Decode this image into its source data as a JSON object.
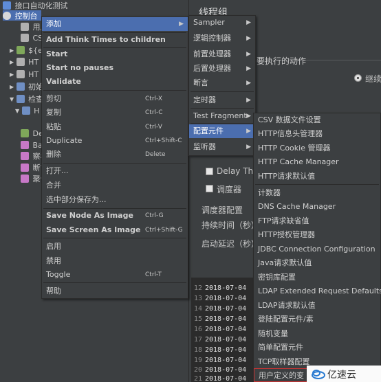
{
  "tree": {
    "root_label": "接口自动化测试",
    "selected_label": "控制台",
    "items": [
      "用户",
      "CSV",
      "${e",
      "HT",
      "HT",
      "初始",
      "检查",
      "H",
      "Del",
      "Bac",
      "察看",
      "断言",
      "聚合"
    ]
  },
  "right_pane": {
    "title": "线程组",
    "action_label": "要执行的动作",
    "radio_label": "继续",
    "delay_label": "Delay Thre",
    "scheduler_label": "调度器",
    "scheduler_config_label": "调度器配置",
    "duration_label": "持续时间（秒）",
    "startup_delay_label": "启动延迟（秒）"
  },
  "log": {
    "lines": [
      {
        "num": "12",
        "text": "2018-07-04"
      },
      {
        "num": "13",
        "text": "2018-07-04"
      },
      {
        "num": "14",
        "text": "2018-07-04"
      },
      {
        "num": "15",
        "text": "2018-07-04"
      },
      {
        "num": "16",
        "text": "2018-07-04"
      },
      {
        "num": "17",
        "text": "2018-07-04"
      },
      {
        "num": "18",
        "text": "2018-07-04"
      },
      {
        "num": "19",
        "text": "2018-07-04"
      },
      {
        "num": "20",
        "text": "2018-07-04"
      },
      {
        "num": "21",
        "text": "2018-07-04"
      }
    ]
  },
  "context_menu": {
    "add": "添加",
    "add_think_times": "Add Think Times to children",
    "start": "Start",
    "start_no_pauses": "Start no pauses",
    "validate": "Validate",
    "cut": "剪切",
    "cut_sc": "Ctrl-X",
    "copy": "复制",
    "copy_sc": "Ctrl-C",
    "paste": "粘贴",
    "paste_sc": "Ctrl-V",
    "duplicate": "Duplicate",
    "duplicate_sc": "Ctrl+Shift-C",
    "delete": "删除",
    "delete_sc": "Delete",
    "open": "打开...",
    "merge": "合并",
    "save_selection": "选中部分保存为...",
    "save_node_image": "Save Node As Image",
    "save_node_image_sc": "Ctrl-G",
    "save_screen_image": "Save Screen As Image",
    "save_screen_image_sc": "Ctrl+Shift-G",
    "enable": "启用",
    "disable": "禁用",
    "toggle": "Toggle",
    "toggle_sc": "Ctrl-T",
    "help": "帮助"
  },
  "add_submenu": {
    "sampler": "Sampler",
    "logic_controller": "逻辑控制器",
    "pre_processor": "前置处理器",
    "post_processor": "后置处理器",
    "assertion": "断言",
    "timer": "定时器",
    "test_fragment": "Test Fragment",
    "config_element": "配置元件",
    "listener": "监听器"
  },
  "config_submenu": {
    "items": [
      "CSV 数据文件设置",
      "HTTP信息头管理器",
      "HTTP Cookie 管理器",
      "HTTP Cache Manager",
      "HTTP请求默认值",
      "计数器",
      "DNS Cache Manager",
      "FTP请求缺省值",
      "HTTP授权管理器",
      "JDBC Connection Configuration",
      "Java请求默认值",
      "密钥库配置",
      "LDAP Extended Request Defaults",
      "LDAP请求默认值",
      "登陆配置元件/素",
      "随机变量",
      "简单配置元件",
      "TCP取样器配置",
      "用户定义的变"
    ]
  },
  "watermark": {
    "text": "亿速云"
  }
}
